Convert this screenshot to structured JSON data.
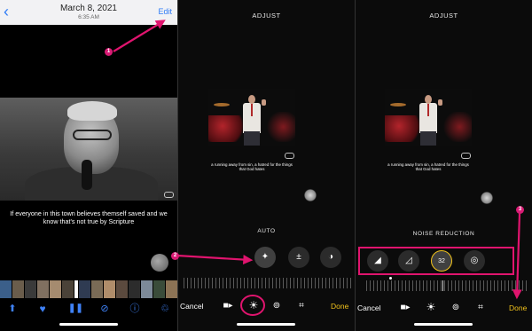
{
  "panel1": {
    "back_icon": "chevron-left-icon",
    "date": "March 8, 2021",
    "time": "6:35 AM",
    "edit_label": "Edit",
    "subtitle": "If everyone in this town believes themself saved and we know that's not true by Scripture",
    "filmstrip_colors": [
      "#3b5f8a",
      "#6a5d4c",
      "#3a3a3a",
      "#807060",
      "#a58b6f",
      "#4a4238",
      "#1e1e1e",
      "#2f3b52",
      "#7a6b56",
      "#b08d6a",
      "#5b4a3e",
      "#2c2c2c",
      "#7d8a99",
      "#3a4c3a",
      "#8c7355"
    ],
    "toolbar_icons": [
      "share-icon",
      "heart-icon",
      "pause-icon",
      "mute-icon",
      "info-icon",
      "trash-icon"
    ],
    "toolbar_color": "#3f82f7"
  },
  "panel2": {
    "title": "ADJUST",
    "subtitle": "a running away from sin, a hatred for the things that God hates",
    "section_label": "AUTO",
    "tool_icons": [
      "magic-wand-icon",
      "exposure-icon",
      "brilliance-icon"
    ],
    "cancel_label": "Cancel",
    "done_label": "Done",
    "done_color": "#f1c21b"
  },
  "panel3": {
    "title": "ADJUST",
    "subtitle": "a running away from sin, a hatred for the things that God hates",
    "section_label": "NOISE REDUCTION",
    "tool_icons": [
      "sharpness-icon",
      "definition-icon",
      "noise-reduction-icon",
      "vignette-icon"
    ],
    "noise_value": "32",
    "cancel_label": "Cancel",
    "done_label": "Done",
    "done_color": "#f1c21b"
  },
  "annotations": {
    "steps": [
      "1",
      "2",
      "3"
    ],
    "color": "#e0146e"
  }
}
